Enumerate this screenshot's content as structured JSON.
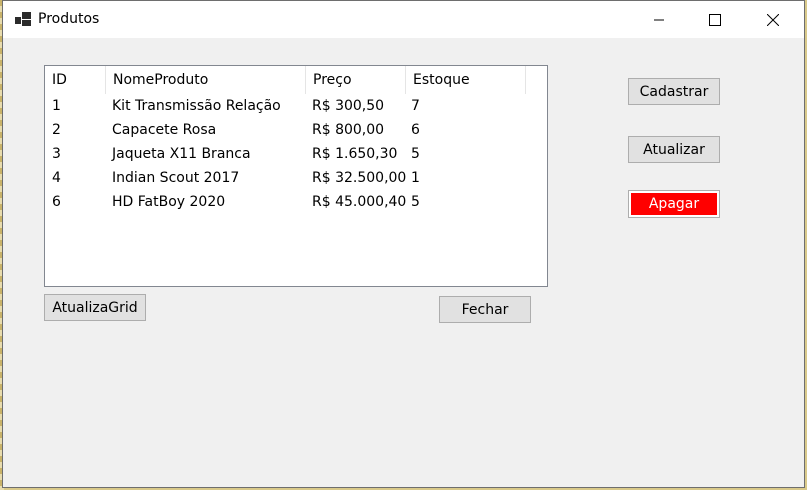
{
  "window": {
    "title": "Produtos"
  },
  "grid": {
    "columns": [
      "ID",
      "NomeProduto",
      "Preço",
      "Estoque"
    ],
    "rows": [
      [
        "1",
        "Kit Transmissão Relação",
        "R$ 300,50",
        "7"
      ],
      [
        "2",
        "Capacete Rosa",
        "R$ 800,00",
        "6"
      ],
      [
        "3",
        "Jaqueta X11 Branca",
        "R$ 1.650,30",
        "5"
      ],
      [
        "4",
        "Indian Scout 2017",
        "R$ 32.500,00",
        "1"
      ],
      [
        "6",
        "HD FatBoy 2020",
        "R$ 45.000,40",
        "5"
      ]
    ]
  },
  "buttons": {
    "cadastrar": "Cadastrar",
    "atualizar": "Atualizar",
    "apagar": "Apagar",
    "atualiza_grid": "AtualizaGrid",
    "fechar": "Fechar"
  },
  "colors": {
    "danger": "#ff0000"
  }
}
